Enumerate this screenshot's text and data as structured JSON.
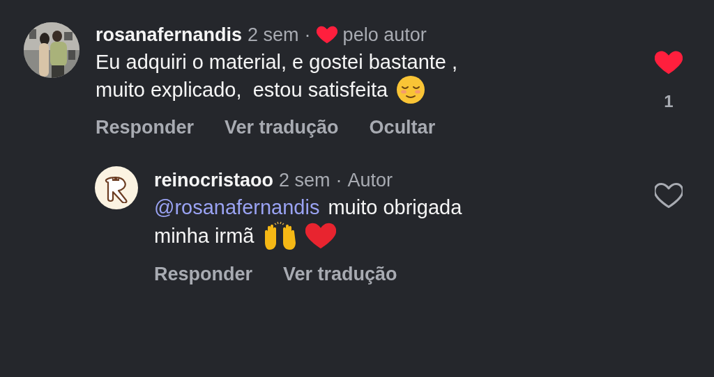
{
  "comments": [
    {
      "username": "rosanafernandis",
      "time": "2 sem",
      "badge": {
        "kind": "liked_by_author",
        "separator": "·",
        "label": "pelo autor"
      },
      "avatar": {
        "kind": "picture"
      },
      "lines": [
        "Eu adquiri o material, e gostei bastante ,",
        "muito explicado,  estou satisfeita"
      ],
      "liked": true,
      "like_count": "1",
      "actions": [
        "Responder",
        "Ver tradução",
        "Ocultar"
      ],
      "replies": [
        {
          "username": "reinocristaoo",
          "time": "2 sem",
          "badge": {
            "kind": "author",
            "separator": "·",
            "label": "Autor"
          },
          "avatar": {
            "kind": "logo"
          },
          "mention": "@rosanafernandis",
          "lines": [
            "muito obrigada",
            "minha irmã"
          ],
          "liked": false,
          "actions": [
            "Responder",
            "Ver tradução"
          ]
        }
      ]
    }
  ]
}
